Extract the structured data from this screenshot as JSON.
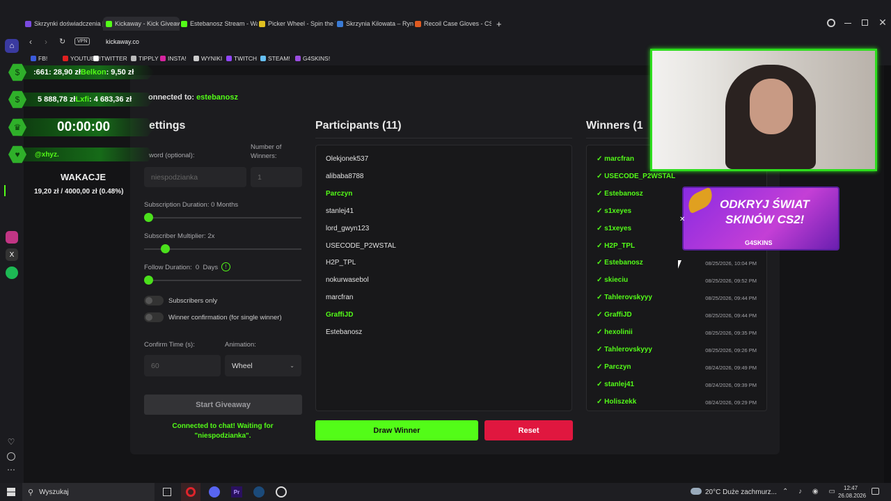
{
  "browser": {
    "tabs": [
      {
        "label": "Skrzynki doświadczenia | ",
        "color": "#7a4ae0"
      },
      {
        "label": "Kickaway - Kick Giveaway",
        "color": "#53fc18",
        "active": true
      },
      {
        "label": "Estebanosz Stream - Watc",
        "color": "#53fc18"
      },
      {
        "label": "Picker Wheel - Spin the W",
        "color": "#e0c020"
      },
      {
        "label": "Skrzynia Kilowata – Rynek",
        "color": "#3a7bd5"
      },
      {
        "label": "Recoil Case Gloves - CS2",
        "color": "#e05a20"
      }
    ],
    "new_tab": "+",
    "url": "kickaway.co",
    "vpn": "VPN",
    "bookmarks": [
      {
        "label": "FB!",
        "color": "#3b5bdb"
      },
      {
        "label": "YOUTUBE!",
        "color": "#e02020"
      },
      {
        "label": "TWITTER",
        "color": "#ffffff"
      },
      {
        "label": "TIPPLY",
        "color": "#bbbbbb"
      },
      {
        "label": "INSTA!",
        "color": "#d6249f"
      },
      {
        "label": "WYNIKI",
        "color": "#cccccc"
      },
      {
        "label": "TWITCH",
        "color": "#9146ff"
      },
      {
        "label": "STEAM!",
        "color": "#66c0f4"
      },
      {
        "label": "G4SKINS!",
        "color": "#9b4de0"
      }
    ]
  },
  "app": {
    "connected_prefix": "onnected to: ",
    "connected_channel": "estebanosz",
    "settings": {
      "title": "ettings",
      "keyword_label": "word (optional):",
      "keyword_value": "niespodzianka",
      "winners_label": "Number of Winners:",
      "winners_value": "1",
      "sub_duration_label": "Subscription Duration: 0 Months",
      "sub_multiplier_label": "Subscriber Multiplier: 2x",
      "follow_duration_label": "Follow Duration:  0  Days",
      "follow_info_icon": "!",
      "subscribers_only_label": "Subscribers only",
      "winner_confirm_label": "Winner confirmation (for single winner)",
      "confirm_time_label": "Confirm Time (s):",
      "confirm_time_value": "60",
      "animation_label": "Animation:",
      "animation_value": "Wheel",
      "start_button": "Start Giveaway",
      "status_text": "Connected to chat! Waiting for \"niespodzianka\"."
    },
    "participants": {
      "title": "Participants (11)",
      "items": [
        {
          "name": "Olekjonek537",
          "hl": false
        },
        {
          "name": "alibaba8788",
          "hl": false
        },
        {
          "name": "Parczyn",
          "hl": true
        },
        {
          "name": "stanlej41",
          "hl": false
        },
        {
          "name": "lord_gwyn123",
          "hl": false
        },
        {
          "name": "USECODE_P2WSTAL",
          "hl": false
        },
        {
          "name": "H2P_TPL",
          "hl": false
        },
        {
          "name": "nokurwasebol",
          "hl": false
        },
        {
          "name": "marcfran",
          "hl": false
        },
        {
          "name": "GraffiJD",
          "hl": true
        },
        {
          "name": "Estebanosz",
          "hl": false
        }
      ]
    },
    "winners": {
      "title": "Winners (1",
      "items": [
        {
          "name": "marcfran",
          "date": ""
        },
        {
          "name": "USECODE_P2WSTAL",
          "date": ""
        },
        {
          "name": "Estebanosz",
          "date": ""
        },
        {
          "name": "s1xeyes",
          "date": ""
        },
        {
          "name": "s1xeyes",
          "date": ""
        },
        {
          "name": "H2P_TPL",
          "date": ""
        },
        {
          "name": "Estebanosz",
          "date": "08/25/2026, 10:04 PM"
        },
        {
          "name": "skieciu",
          "date": "08/25/2026, 09:52 PM"
        },
        {
          "name": "Tahlerovskyyy",
          "date": "08/25/2026, 09:44 PM"
        },
        {
          "name": "GraffiJD",
          "date": "08/25/2026, 09:44 PM"
        },
        {
          "name": "hexolinii",
          "date": "08/25/2026, 09:35 PM"
        },
        {
          "name": "Tahlerovskyyy",
          "date": "08/25/2026, 09:26 PM"
        },
        {
          "name": "Parczyn",
          "date": "08/24/2026, 09:49 PM"
        },
        {
          "name": "stanlej41",
          "date": "08/24/2026, 09:39 PM"
        },
        {
          "name": "Holiszekk",
          "date": "08/24/2026, 09:29 PM"
        }
      ]
    },
    "draw_button": "Draw Winner",
    "reset_button": "Reset"
  },
  "overlay": {
    "donations_top": "!661: 28,90 zł Belkon: 9,50 zł",
    "donations_top_pre": ":661: 28,90 zł",
    "donations_top_mid": "Belkon",
    "donations_top_post": ": 9,50 zł",
    "donations_2_pre": "5 888,78 zł ",
    "donations_2_mid": "Lxfi",
    "donations_2_post": ": 4 683,36 zł",
    "timer": "00:00:00",
    "handle": "@xhyz.",
    "goal_title": "WAKACJE",
    "goal_progress": "19,20 zł / 4000,00 zł",
    "goal_percent": "(0.48%)",
    "ad_line1": "ODKRYJ ŚWIAT",
    "ad_line2": "SKINÓW CS2!",
    "ad_brand": "G4SKINS"
  },
  "taskbar": {
    "search": "Wyszukaj",
    "weather": "20°C  Duże zachmurz...",
    "time": "12:47",
    "date": "26.08.2026"
  }
}
